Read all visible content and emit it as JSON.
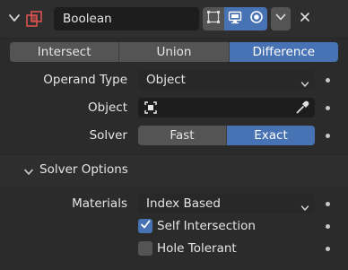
{
  "modifier": {
    "name": "Boolean"
  },
  "operations": {
    "items": [
      "Intersect",
      "Union",
      "Difference"
    ],
    "selected": "Difference"
  },
  "properties": {
    "operand_type": {
      "label": "Operand Type",
      "value": "Object"
    },
    "object": {
      "label": "Object",
      "value": ""
    },
    "solver": {
      "label": "Solver",
      "options": [
        "Fast",
        "Exact"
      ],
      "selected": "Exact"
    }
  },
  "solver_options": {
    "title": "Solver Options",
    "materials": {
      "label": "Materials",
      "value": "Index Based"
    },
    "self_intersection": {
      "label": "Self Intersection",
      "checked": true
    },
    "hole_tolerant": {
      "label": "Hole Tolerant",
      "checked": false
    }
  },
  "colors": {
    "accent": "#4772b3",
    "background": "#2b2b2b",
    "modifier_icon": "#d9534f"
  },
  "icons": [
    "chevron-down-icon",
    "boolean-modifier-icon",
    "edit-mode-icon",
    "realtime-icon",
    "render-icon",
    "close-icon",
    "object-icon",
    "eyedropper-icon",
    "checkmark-icon"
  ]
}
